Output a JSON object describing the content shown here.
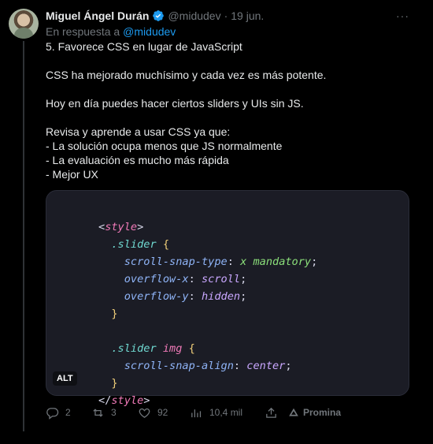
{
  "tweet": {
    "author_name": "Miguel Ángel Durán",
    "handle": "@midudev",
    "separator": "·",
    "date": "19 jun.",
    "more": "···",
    "reply_prefix": "En respuesta a",
    "reply_mention": "@midudev",
    "text_lines": [
      "5. Favorece CSS en lugar de JavaScript",
      "",
      "CSS ha mejorado muchísimo y cada vez es más potente.",
      "",
      "Hoy en día puedes hacer ciertos sliders y UIs sin JS.",
      "",
      "Revisa y aprende a usar CSS ya que:",
      "- La solución ocupa menos que JS normalmente",
      "- La evaluación es mucho más rápida",
      "- Mejor UX"
    ]
  },
  "media": {
    "alt_badge": "ALT",
    "code": {
      "tag_open_lt": "<",
      "tag_name": "style",
      "tag_open_gt": ">",
      "sel1": ".slider",
      "brace_open": "{",
      "brace_close": "}",
      "prop1": "scroll-snap-type",
      "val1a": "x",
      "val1b": "mandatory",
      "prop2": "overflow-x",
      "val2": "scroll",
      "prop3": "overflow-y",
      "val3": "hidden",
      "sel2": ".slider",
      "sel2_el": "img",
      "prop4": "scroll-snap-align",
      "val4": "center",
      "colon": ":",
      "semicolon": ";",
      "tag_close_lt": "</",
      "tag_close_name": "style",
      "tag_close_gt": ">"
    }
  },
  "actions": {
    "replies": "2",
    "retweets": "3",
    "likes": "92",
    "views": "10,4 mil",
    "promote_label": "Promina"
  },
  "icons": [
    "verified-badge-icon",
    "more-icon",
    "reply-icon",
    "retweet-icon",
    "like-icon",
    "views-icon",
    "share-icon",
    "promote-icon"
  ],
  "colors": {
    "background": "#000000",
    "text": "#e7e9ea",
    "muted": "#71767b",
    "link": "#1d9bf0",
    "code_bg": "#1b1c25"
  }
}
